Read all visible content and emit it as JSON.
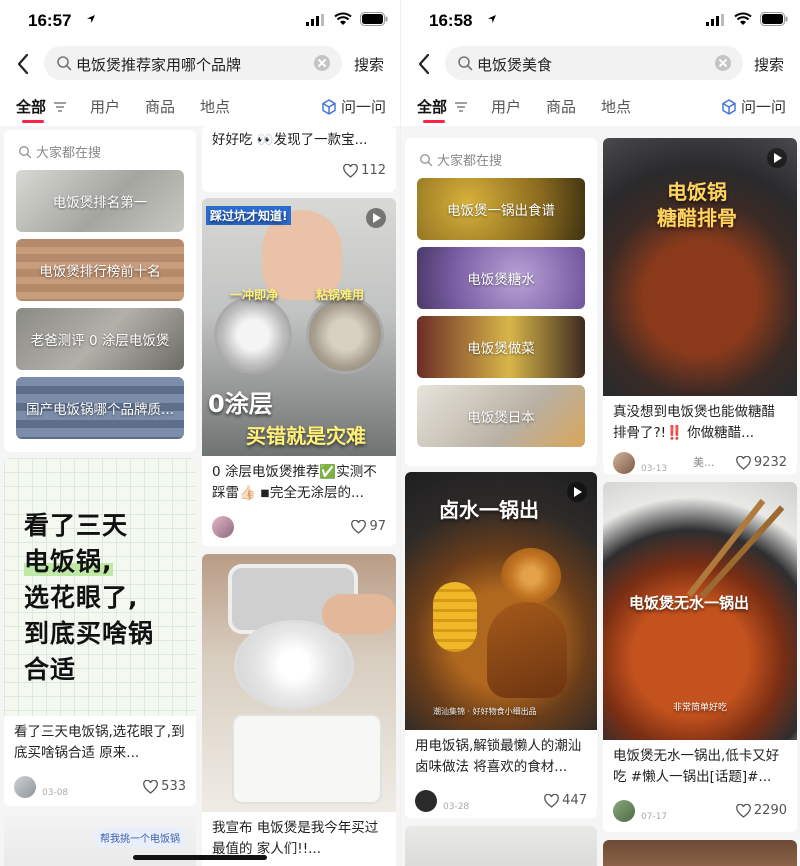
{
  "left": {
    "status": {
      "time": "16:57"
    },
    "search": {
      "query": "电饭煲推荐家用哪个品牌",
      "button": "搜索"
    },
    "tabs": [
      "全部",
      "用户",
      "商品",
      "地点"
    ],
    "ask": "问一问",
    "trending": {
      "header": "大家都在搜",
      "items": [
        "电饭煲排名第一",
        "电饭煲排行榜前十名",
        "老爸测评 0 涂层电饭煲",
        "国产电饭锅哪个品牌质..."
      ]
    },
    "cards": {
      "top_right": {
        "title": "好好吃 👀发现了一款宝...",
        "likes": "112"
      },
      "coating": {
        "overlay_top": "踩过坑才知道!",
        "overlay_a": "一冲即净",
        "overlay_b": "粘锅难用",
        "overlay_c": "0涂层",
        "overlay_d": "买错就是灾难",
        "title": "0 涂层电饭煲推荐✅实测不踩雷👍🏻 ◾完全无涂层的...",
        "likes": "97"
      },
      "three_days": {
        "big_lines": [
          "看了三天",
          "电饭锅,",
          "选花眼了,",
          "到底买啥锅",
          "合适"
        ],
        "title": "看了三天电饭锅,选花眼了,到底买啥锅合适 原来...",
        "date": "03-08",
        "likes": "533"
      },
      "steamer": {
        "title": "我宣布 电饭煲是我今年买过最值的 家人们!!..."
      },
      "bottom_left": {
        "tag": "帮我挑一个电饭锅"
      }
    }
  },
  "right": {
    "status": {
      "time": "16:58"
    },
    "search": {
      "query": "电饭煲美食",
      "button": "搜索"
    },
    "tabs": [
      "全部",
      "用户",
      "商品",
      "地点"
    ],
    "ask": "问一问",
    "trending": {
      "header": "大家都在搜",
      "items": [
        "电饭煲一锅出食谱",
        "电饭煲糖水",
        "电饭煲做菜",
        "电饭煲日本"
      ]
    },
    "cards": {
      "ribs": {
        "overlay": [
          "电饭锅",
          "糖醋排骨"
        ],
        "title": "真没想到电饭煲也能做糖醋排骨了?!‼️ 你做糖醋...",
        "user": "美...",
        "date": "03-13",
        "likes": "9232"
      },
      "lu": {
        "overlay": "卤水一锅出",
        "caption": "潮汕集锦 · 好好物食小细出品",
        "title": "用电饭锅,解锁最懒人的潮汕卤味做法 将喜欢的食材...",
        "date": "03-28",
        "likes": "447"
      },
      "chicken": {
        "overlay": "电饭煲无水一锅出",
        "subtitle": "非常简单好吃",
        "title": "电饭煲无水一锅出,低卡又好吃 #懒人一锅出[话题]#...",
        "date": "07-17",
        "likes": "2290"
      }
    }
  },
  "colors": {
    "accent": "#ff2442",
    "bg": "#f5f5f5"
  },
  "icons": [
    "back-arrow-icon",
    "search-icon",
    "clear-icon",
    "filter-icon",
    "ask-cube-icon",
    "heart-icon",
    "play-icon"
  ]
}
